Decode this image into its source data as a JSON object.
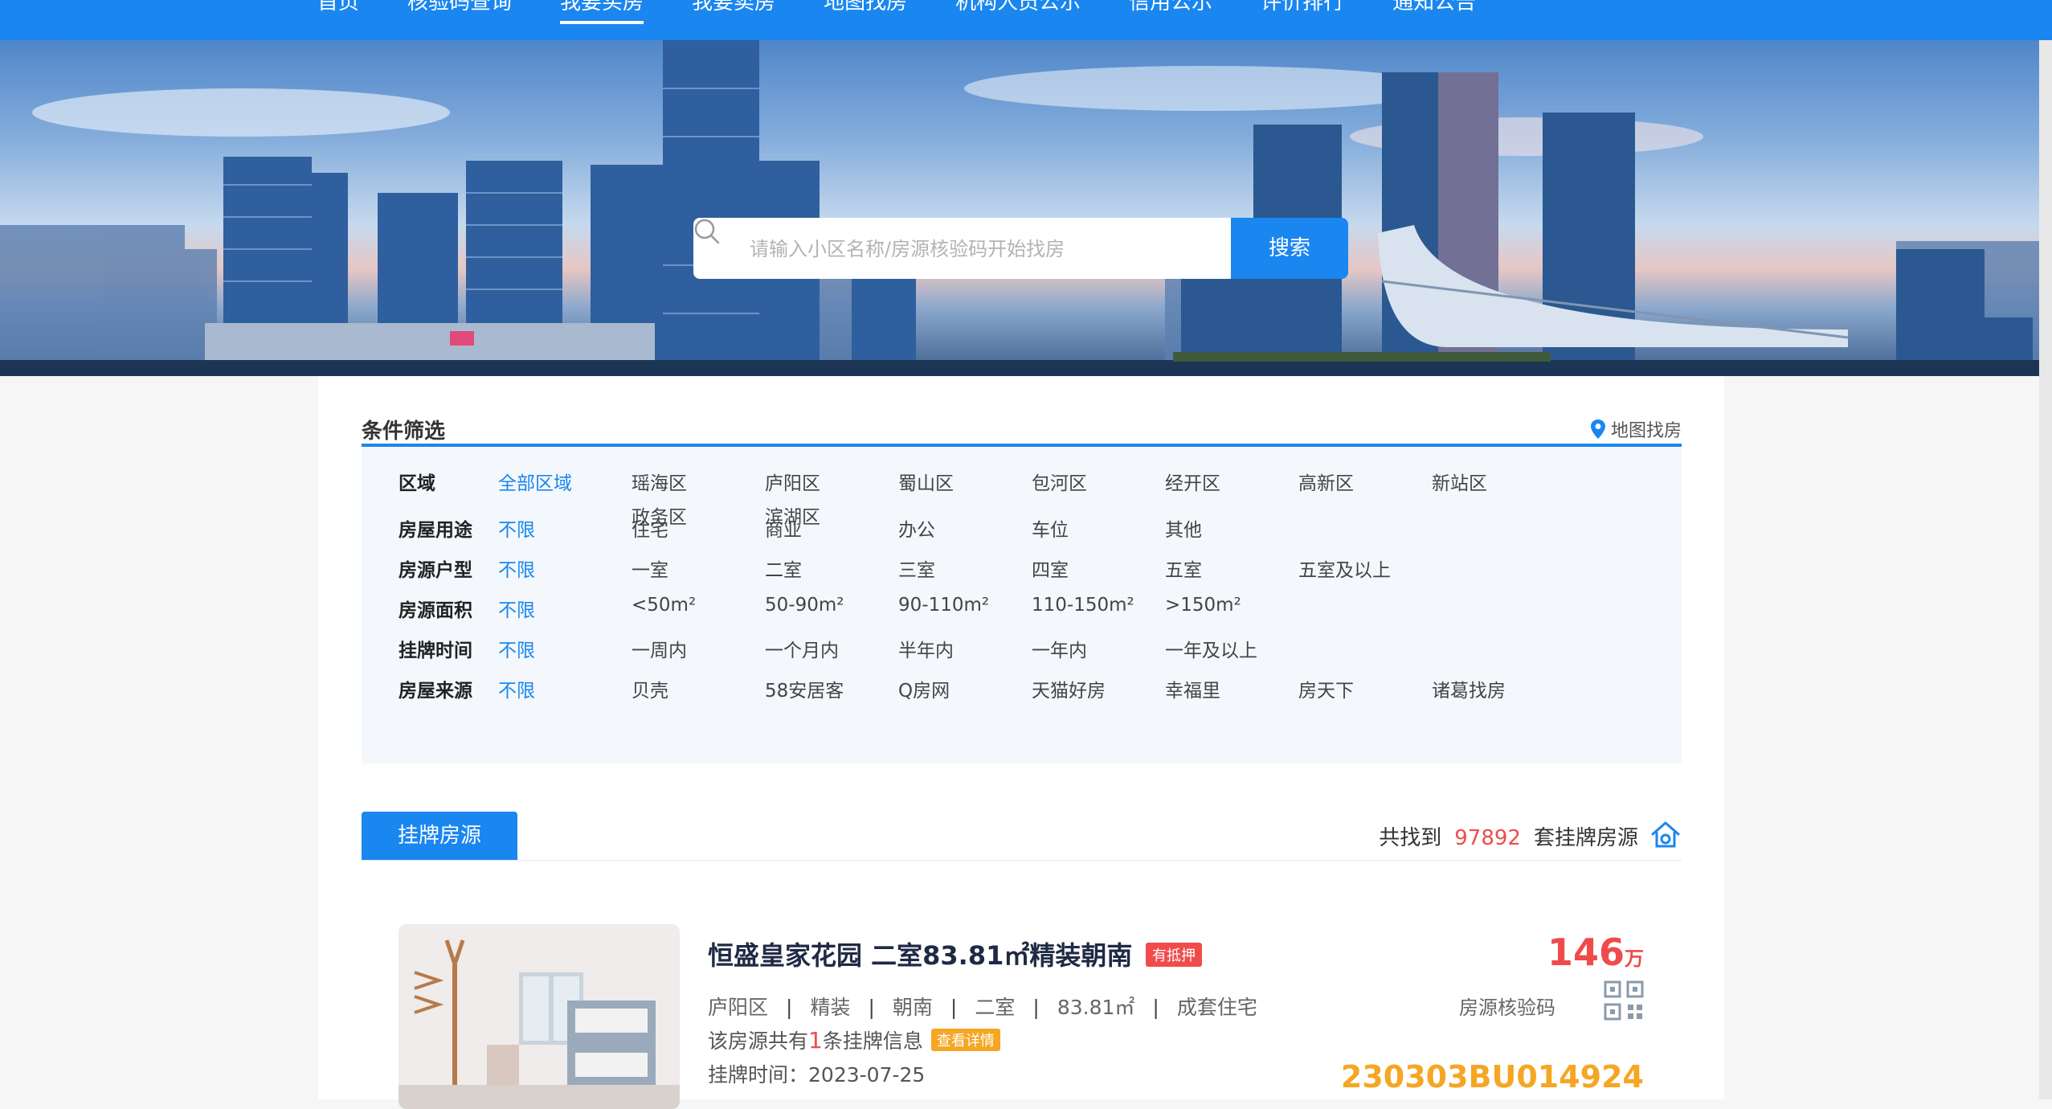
{
  "nav": {
    "items": [
      "首页",
      "核验码查询",
      "我要买房",
      "我要卖房",
      "地图找房",
      "机构人员公示",
      "信用公示",
      "评价排行",
      "通知公告"
    ],
    "active_index": 2
  },
  "search": {
    "placeholder": "请输入小区名称/房源核验码开始找房",
    "button_label": "搜索"
  },
  "filter": {
    "title": "条件筛选",
    "map_link": "地图找房",
    "rows": [
      {
        "label": "区域",
        "options": [
          "全部区域",
          "瑶海区",
          "庐阳区",
          "蜀山区",
          "包河区",
          "经开区",
          "高新区",
          "新站区",
          "政务区",
          "滨湖区"
        ]
      },
      {
        "label": "房屋用途",
        "options": [
          "不限",
          "住宅",
          "商业",
          "办公",
          "车位",
          "其他"
        ]
      },
      {
        "label": "房源户型",
        "options": [
          "不限",
          "一室",
          "二室",
          "三室",
          "四室",
          "五室",
          "五室及以上"
        ]
      },
      {
        "label": "房源面积",
        "options": [
          "不限",
          "<50m²",
          "50-90m²",
          "90-110m²",
          "110-150m²",
          ">150m²"
        ]
      },
      {
        "label": "挂牌时间",
        "options": [
          "不限",
          "一周内",
          "一个月内",
          "半年内",
          "一年内",
          "一年及以上"
        ]
      },
      {
        "label": "房屋来源",
        "options": [
          "不限",
          "贝壳",
          "58安居客",
          "Q房网",
          "天猫好房",
          "幸福里",
          "房天下",
          "诸葛找房"
        ]
      }
    ]
  },
  "listings": {
    "tab_label": "挂牌房源",
    "found_prefix": "共找到",
    "found_count": "97892",
    "found_suffix": "套挂牌房源"
  },
  "card": {
    "title": "恒盛皇家花园 二室83.81㎡精装朝南",
    "mortgage_tag": "有抵押",
    "meta": [
      "庐阳区",
      "精装",
      "朝南",
      "二室",
      "83.81㎡",
      "成套住宅"
    ],
    "count_prefix": "该房源共有",
    "count_value": "1",
    "count_suffix": "条挂牌信息",
    "detail_tag": "查看详情",
    "date_label": "挂牌时间：",
    "date_value": "2023-07-25",
    "price_value": "146",
    "price_unit": "万",
    "verify_label": "房源核验码",
    "verify_code": "230303BU014924"
  },
  "colors": {
    "primary": "#1a86f0",
    "price_red": "#f04b4b",
    "code_orange": "#f5a623"
  }
}
